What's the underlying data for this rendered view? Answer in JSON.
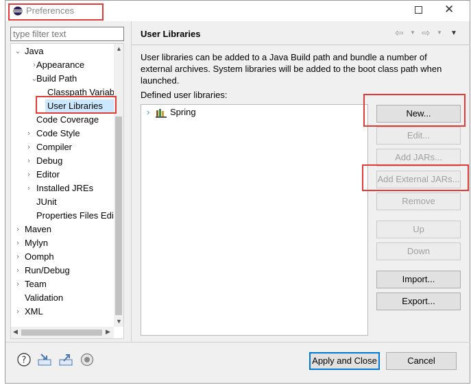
{
  "window": {
    "title": "Preferences"
  },
  "filter": {
    "placeholder": "type filter text"
  },
  "tree": {
    "java": "Java",
    "appearance": "Appearance",
    "build_path": "Build Path",
    "classpath_variables": "Classpath Variab",
    "user_libraries": "User Libraries",
    "code_coverage": "Code Coverage",
    "code_style": "Code Style",
    "compiler": "Compiler",
    "debug": "Debug",
    "editor": "Editor",
    "installed_jres": "Installed JREs",
    "junit": "JUnit",
    "properties_files_editor": "Properties Files Edi",
    "maven": "Maven",
    "mylyn": "Mylyn",
    "oomph": "Oomph",
    "run_debug": "Run/Debug",
    "team": "Team",
    "validation": "Validation",
    "xml": "XML"
  },
  "page": {
    "title": "User Libraries",
    "description": "User libraries can be added to a Java Build path and bundle a number of external archives. System libraries will be added to the boot class path when launched.",
    "defined_label": "Defined user libraries:",
    "libraries": [
      "Spring"
    ]
  },
  "buttons": {
    "new": "New...",
    "edit": "Edit...",
    "add_jars": "Add JARs...",
    "add_external_jars": "Add External JARs...",
    "remove": "Remove",
    "up": "Up",
    "down": "Down",
    "import": "Import...",
    "export": "Export...",
    "apply_close": "Apply and Close",
    "cancel": "Cancel"
  },
  "colors": {
    "highlight": "#e53935",
    "selected_bg": "#cce8ff"
  }
}
